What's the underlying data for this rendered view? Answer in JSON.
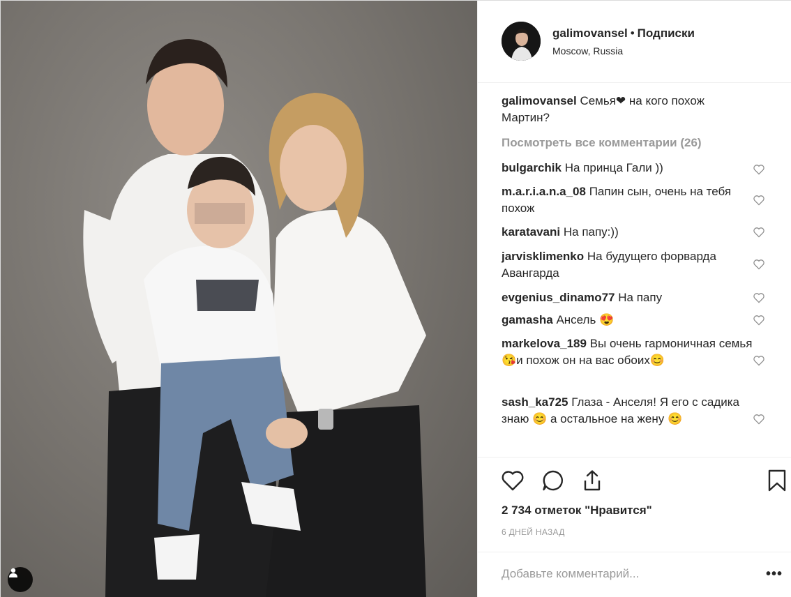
{
  "header": {
    "username": "galimovansel",
    "separator": "•",
    "follow_label": "Подписки",
    "location": "Moscow, Russia"
  },
  "caption": {
    "username": "galimovansel",
    "text": "Семья❤ на кого похож Мартин?"
  },
  "view_all_label": "Посмотреть все комментарии (26)",
  "comments": [
    {
      "user": "bulgarchik",
      "text": "На принца Гали ))"
    },
    {
      "user": "m.a.r.i.a.n.a_08",
      "text": "Папин сын, очень на тебя похож"
    },
    {
      "user": "karatavani",
      "text": "На папу:))"
    },
    {
      "user": "jarvisklimenko",
      "text": "На будущего форварда Авангарда"
    },
    {
      "user": "evgenius_dinamo77",
      "text": "На папу"
    },
    {
      "user": "gamasha",
      "text": "Ансель 😍"
    },
    {
      "user": "markelova_189",
      "text": "Вы очень гармоничная семья😘и похож он на вас обоих😊"
    },
    {
      "user": "sash_ka725",
      "text": "Глаза - Анселя! Я его с садика знаю 😊 а остальное на жену 😊"
    }
  ],
  "likes_text": "2 734 отметок \"Нравится\"",
  "time_text": "6 ДНЕЙ НАЗАД",
  "add_comment_placeholder": "Добавьте комментарий...",
  "more_label": "•••",
  "icons": {
    "like": "heart-icon",
    "comment": "comment-icon",
    "share": "share-icon",
    "save": "bookmark-icon",
    "tagged": "user-tag-icon"
  },
  "colors": {
    "text": "#262626",
    "muted": "#999999",
    "border": "#efefef"
  }
}
